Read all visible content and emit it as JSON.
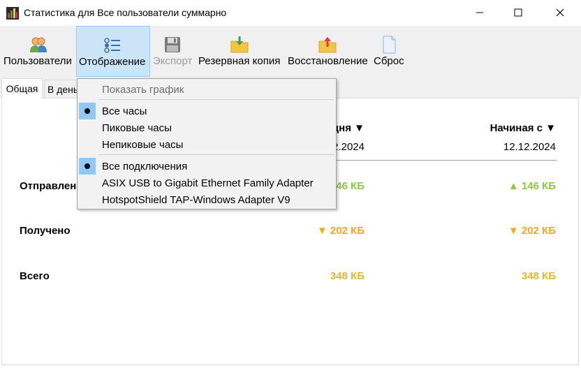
{
  "window": {
    "title": "Статистика для Все пользователи суммарно"
  },
  "toolbar": {
    "items": [
      {
        "label": "Пользователи",
        "icon": "users-icon"
      },
      {
        "label": "Отображение",
        "icon": "display-settings-icon"
      },
      {
        "label": "Экспорт",
        "icon": "floppy-disk-icon"
      },
      {
        "label": "Резервная копия",
        "icon": "backup-folder-icon"
      },
      {
        "label": "Восстановление",
        "icon": "restore-folder-icon"
      },
      {
        "label": "Сброс",
        "icon": "blank-page-icon"
      }
    ]
  },
  "tabs": [
    {
      "label": "Общая"
    },
    {
      "label": "В день"
    }
  ],
  "columns": [
    {
      "header": "дня ▼",
      "date": "2.2024"
    },
    {
      "header": "Начиная с ▼",
      "date": "12.12.2024"
    }
  ],
  "rows": [
    {
      "label": "Отправлено",
      "values": [
        "46 КБ",
        "▲ 146 КБ"
      ]
    },
    {
      "label": "Получено",
      "values": [
        "▼ 202 КБ",
        "▼ 202 КБ"
      ]
    },
    {
      "label": "Всего",
      "values": [
        "348 КБ",
        "348 КБ"
      ]
    }
  ],
  "menu": {
    "show_chart": "Показать график",
    "hours": [
      "Все часы",
      "Пиковые часы",
      "Непиковые часы"
    ],
    "connections": [
      "Все подключения",
      "ASIX USB to Gigabit Ethernet Family Adapter",
      "HotspotShield TAP-Windows Adapter V9"
    ]
  },
  "colors": {
    "sent": "#8dc63f",
    "received": "#f5a623",
    "total": "#e0b92a",
    "selection": "#cce4f7"
  }
}
